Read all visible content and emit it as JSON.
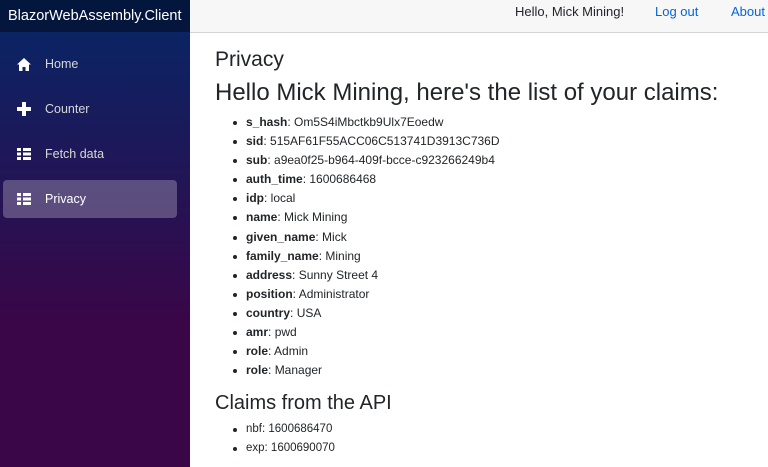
{
  "brand": "BlazorWebAssembly.Client",
  "header": {
    "greeting": "Hello, Mick Mining!",
    "logout_label": "Log out",
    "about_label": "About"
  },
  "nav": [
    {
      "label": "Home",
      "icon": "home-icon"
    },
    {
      "label": "Counter",
      "icon": "plus-icon"
    },
    {
      "label": "Fetch data",
      "icon": "list-icon"
    },
    {
      "label": "Privacy",
      "icon": "list-icon",
      "active": true
    }
  ],
  "main": {
    "page_title": "Privacy",
    "claims_heading": "Hello Mick Mining, here's the list of your claims:",
    "claims": [
      {
        "key": "s_hash",
        "value": "Om5S4iMbctkb9Ulx7Eoedw"
      },
      {
        "key": "sid",
        "value": "515AF61F55ACC06C513741D3913C736D"
      },
      {
        "key": "sub",
        "value": "a9ea0f25-b964-409f-bcce-c923266249b4"
      },
      {
        "key": "auth_time",
        "value": "1600686468"
      },
      {
        "key": "idp",
        "value": "local"
      },
      {
        "key": "name",
        "value": "Mick Mining"
      },
      {
        "key": "given_name",
        "value": "Mick"
      },
      {
        "key": "family_name",
        "value": "Mining"
      },
      {
        "key": "address",
        "value": "Sunny Street 4"
      },
      {
        "key": "position",
        "value": "Administrator"
      },
      {
        "key": "country",
        "value": "USA"
      },
      {
        "key": "amr",
        "value": "pwd"
      },
      {
        "key": "role",
        "value": "Admin"
      },
      {
        "key": "role",
        "value": "Manager"
      }
    ],
    "api_heading": "Claims from the API",
    "api_claims": [
      "nbf: 1600686470",
      "exp: 1600690070"
    ]
  },
  "colors": {
    "sidebar_top": "#052767",
    "sidebar_bottom": "#3a0647",
    "link": "#0366d6",
    "topbar": "#f7f7f7"
  }
}
